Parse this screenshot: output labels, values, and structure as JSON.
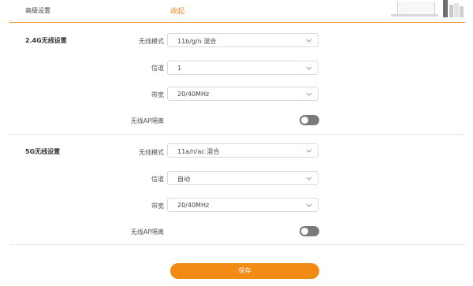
{
  "header": {
    "title": "高级设置",
    "collapse_link": "收起"
  },
  "band_24": {
    "section_title": "2.4G无线设置",
    "mode_label": "无线模式",
    "mode_value": "11b/g/n 混合",
    "channel_label": "信道",
    "channel_value": "1",
    "bandwidth_label": "带宽",
    "bandwidth_value": "20/40MHz",
    "ap_isolation_label": "无线AP隔离",
    "ap_isolation_on": false
  },
  "band_5": {
    "section_title": "5G无线设置",
    "mode_label": "无线模式",
    "mode_value": "11a/n/ac 混合",
    "channel_label": "信道",
    "channel_value": "自动",
    "bandwidth_label": "带宽",
    "bandwidth_value": "20/40MHz",
    "ap_isolation_label": "无线AP隔离",
    "ap_isolation_on": false
  },
  "actions": {
    "save_label": "保存"
  },
  "colors": {
    "accent": "#f28b16",
    "toggle_off": "#7a7a7a",
    "header_line": "#f0a244"
  },
  "icons": [
    "chevron-down-icon",
    "computer-illustration",
    "books-illustration"
  ]
}
